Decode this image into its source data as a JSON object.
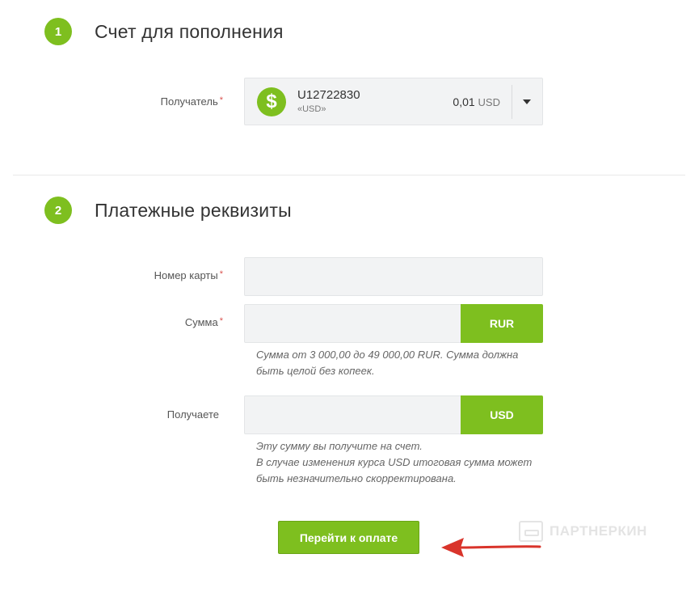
{
  "section1": {
    "step": "1",
    "title": "Счет для пополнения",
    "recipient_label": "Получатель",
    "required_mark": "*",
    "account": {
      "id": "U12722830",
      "currency": "«USD»",
      "balance": "0,01",
      "balance_currency": "USD",
      "icon": "dollar-icon"
    }
  },
  "section2": {
    "step": "2",
    "title": "Платежные реквизиты",
    "card_label": "Номер карты",
    "amount_label": "Сумма",
    "amount_currency": "RUR",
    "amount_hint_line1": "Сумма от 3 000,00 до 49 000,00 RUR. Сумма должна",
    "amount_hint_line2": "быть целой без копеек.",
    "receive_label": "Получаете",
    "receive_currency": "USD",
    "receive_hint_line1": "Эту сумму вы получите на счет.",
    "receive_hint_line2": "В случае изменения курса USD итоговая сумма может",
    "receive_hint_line3": "быть незначительно скорректирована.",
    "required_mark": "*"
  },
  "submit": {
    "label": "Перейти к оплате"
  },
  "watermark": {
    "text": "ПАРТНЕРКИН"
  },
  "colors": {
    "accent": "#7ebf1f",
    "arrow": "#d9342b"
  }
}
